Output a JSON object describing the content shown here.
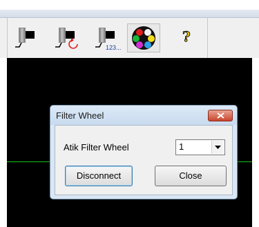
{
  "toolbar": {
    "buttons": [
      {
        "name": "camera-connect",
        "icon": "camera-plug-icon"
      },
      {
        "name": "camera-refresh",
        "icon": "camera-refresh-icon"
      },
      {
        "name": "camera-sequence",
        "icon": "camera-123-icon",
        "badge": "123..."
      },
      {
        "name": "filter-wheel",
        "icon": "filter-wheel-icon",
        "selected": true
      },
      {
        "name": "help",
        "icon": "help-icon",
        "glyph": "?"
      }
    ]
  },
  "dialog": {
    "title": "Filter Wheel",
    "device_label": "Atik Filter Wheel",
    "position_select": {
      "value": "1"
    },
    "disconnect_label": "Disconnect",
    "close_label": "Close"
  },
  "colors": {
    "viewport_bg": "#000000",
    "guide_line": "#16c416",
    "dialog_frame": "#d9e6f4",
    "close_button": "#c8452d"
  }
}
